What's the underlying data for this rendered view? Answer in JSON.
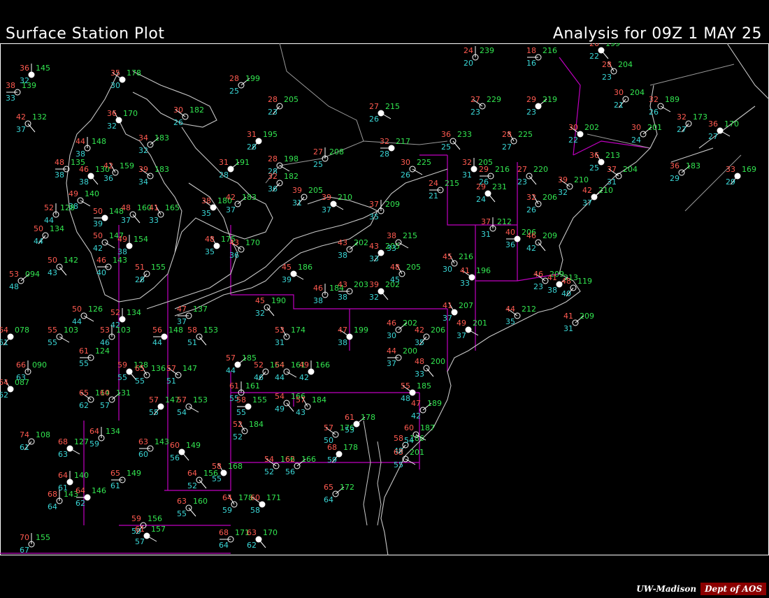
{
  "header": {
    "title_left": "Surface Station Plot",
    "title_right": "Analysis for 09Z  1 MAY 25"
  },
  "footer": {
    "credit_uw": "UW-Madison",
    "credit_dept": "Dept of AOS"
  },
  "colors": {
    "background": "#000000",
    "temperature": "#ff5a50",
    "dewpoint": "#3ad6d6",
    "pressure": "#32e650",
    "coastline": "#c8c8c8",
    "state_border": "#c000c0",
    "station": "#ffffff"
  },
  "stations": [
    {
      "t": "35",
      "td": "30",
      "p": "178"
    },
    {
      "t": "28",
      "td": "25",
      "p": "199"
    },
    {
      "t": "28",
      "td": "23",
      "p": "205"
    },
    {
      "t": "27",
      "td": "26",
      "p": "215"
    },
    {
      "t": "24",
      "td": "20",
      "p": "239"
    },
    {
      "t": "18",
      "td": "16",
      "p": "216"
    },
    {
      "t": "26",
      "td": "22",
      "p": "199"
    },
    {
      "t": "28",
      "td": "23",
      "p": "204"
    },
    {
      "t": "27",
      "td": "23",
      "p": "229"
    },
    {
      "t": "29",
      "td": "23",
      "p": "219"
    },
    {
      "t": "30",
      "td": "21",
      "p": "204"
    },
    {
      "t": "32",
      "td": "26",
      "p": "189"
    },
    {
      "t": "36",
      "td": "32",
      "p": "145"
    },
    {
      "t": "38",
      "td": "33",
      "p": "139"
    },
    {
      "t": "42",
      "td": "37",
      "p": "132"
    },
    {
      "t": "36",
      "td": "32",
      "p": "170"
    },
    {
      "t": "30",
      "td": "26",
      "p": "182"
    },
    {
      "t": "34",
      "td": "32",
      "p": "183"
    },
    {
      "t": "31",
      "td": "28",
      "p": "195"
    },
    {
      "t": "28",
      "td": "28",
      "p": "198"
    },
    {
      "t": "27",
      "td": "25",
      "p": "208"
    },
    {
      "t": "32",
      "td": "28",
      "p": "217"
    },
    {
      "t": "36",
      "td": "25",
      "p": "233"
    },
    {
      "t": "28",
      "td": "27",
      "p": "225"
    },
    {
      "t": "30",
      "td": "22",
      "p": "202"
    },
    {
      "t": "30",
      "td": "24",
      "p": "201"
    },
    {
      "t": "32",
      "td": "27",
      "p": "173"
    },
    {
      "t": "36",
      "td": "27",
      "p": "170"
    },
    {
      "t": "44",
      "td": "38",
      "p": "148"
    },
    {
      "t": "48",
      "td": "38",
      "p": "135"
    },
    {
      "t": "46",
      "td": "38",
      "p": "130"
    },
    {
      "t": "42",
      "td": "36",
      "p": "159"
    },
    {
      "t": "39",
      "td": "34",
      "p": "183"
    },
    {
      "t": "31",
      "td": "28",
      "p": "191"
    },
    {
      "t": "32",
      "td": "36",
      "p": "182"
    },
    {
      "t": "30",
      "td": "26",
      "p": "225"
    },
    {
      "t": "32",
      "td": "31",
      "p": "205"
    },
    {
      "t": "29",
      "td": "26",
      "p": "216"
    },
    {
      "t": "27",
      "td": "23",
      "p": "220"
    },
    {
      "t": "36",
      "td": "25",
      "p": "213"
    },
    {
      "t": "37",
      "td": "31",
      "p": "204"
    },
    {
      "t": "36",
      "td": "29",
      "p": "183"
    },
    {
      "t": "33",
      "td": "29",
      "p": "169"
    },
    {
      "t": "49",
      "td": "38",
      "p": "140"
    },
    {
      "t": "52",
      "td": "44",
      "p": "128"
    },
    {
      "t": "50",
      "td": "39",
      "p": "148"
    },
    {
      "t": "48",
      "td": "37",
      "p": "160"
    },
    {
      "t": "41",
      "td": "33",
      "p": "165"
    },
    {
      "t": "38",
      "td": "35",
      "p": "180"
    },
    {
      "t": "42",
      "td": "37",
      "p": "183"
    },
    {
      "t": "39",
      "td": "31",
      "p": "205"
    },
    {
      "t": "39",
      "td": "37",
      "p": "210"
    },
    {
      "t": "37",
      "td": "35",
      "p": "209"
    },
    {
      "t": "24",
      "td": "21",
      "p": "215"
    },
    {
      "t": "29",
      "td": "24",
      "p": "231"
    },
    {
      "t": "32",
      "td": "26",
      "p": "206"
    },
    {
      "t": "39",
      "td": "32",
      "p": "210"
    },
    {
      "t": "42",
      "td": "37",
      "p": "210"
    },
    {
      "t": "50",
      "td": "44",
      "p": "134"
    },
    {
      "t": "50",
      "td": "42",
      "p": "147"
    },
    {
      "t": "49",
      "td": "38",
      "p": "154"
    },
    {
      "t": "46",
      "td": "40",
      "p": "143"
    },
    {
      "t": "50",
      "td": "43",
      "p": "142"
    },
    {
      "t": "48",
      "td": "35",
      "p": "175"
    },
    {
      "t": "43",
      "td": "36",
      "p": "170"
    },
    {
      "t": "43",
      "td": "38",
      "p": "202"
    },
    {
      "t": "43",
      "td": "33",
      "p": "205"
    },
    {
      "t": "38",
      "td": "33",
      "p": "215"
    },
    {
      "t": "37",
      "td": "31",
      "p": "212"
    },
    {
      "t": "40",
      "td": "36",
      "p": "206"
    },
    {
      "t": "46",
      "td": "42",
      "p": "209"
    },
    {
      "t": "45",
      "td": "30",
      "p": "216"
    },
    {
      "t": "41",
      "td": "33",
      "p": "196"
    },
    {
      "t": "53",
      "td": "48",
      "p": "094"
    },
    {
      "t": "51",
      "td": "28",
      "p": "155"
    },
    {
      "t": "45",
      "td": "39",
      "p": "186"
    },
    {
      "t": "46",
      "td": "38",
      "p": "184"
    },
    {
      "t": "43",
      "td": "38",
      "p": "203"
    },
    {
      "t": "39",
      "td": "32",
      "p": "202"
    },
    {
      "t": "48",
      "td": "45",
      "p": "205"
    },
    {
      "t": "46",
      "td": "23",
      "p": "209"
    },
    {
      "t": "41",
      "td": "38",
      "p": "213"
    },
    {
      "t": "48",
      "td": "40",
      "p": "119"
    },
    {
      "t": "50",
      "td": "44",
      "p": "126"
    },
    {
      "t": "52",
      "td": "42",
      "p": "134"
    },
    {
      "t": "47",
      "td": "37",
      "p": "137"
    },
    {
      "t": "45",
      "td": "32",
      "p": "190"
    },
    {
      "t": "41",
      "td": "37",
      "p": "207"
    },
    {
      "t": "44",
      "td": "35",
      "p": "212"
    },
    {
      "t": "41",
      "td": "31",
      "p": "209"
    },
    {
      "t": "64",
      "td": "61",
      "p": "078"
    },
    {
      "t": "55",
      "td": "55",
      "p": "103"
    },
    {
      "t": "53",
      "td": "46",
      "p": "103"
    },
    {
      "t": "56",
      "td": "44",
      "p": "148"
    },
    {
      "t": "58",
      "td": "51",
      "p": "153"
    },
    {
      "t": "53",
      "td": "31",
      "p": "174"
    },
    {
      "t": "47",
      "td": "38",
      "p": "199"
    },
    {
      "t": "46",
      "td": "30",
      "p": "202"
    },
    {
      "t": "42",
      "td": "35",
      "p": "206"
    },
    {
      "t": "49",
      "td": "37",
      "p": "201"
    },
    {
      "t": "66",
      "td": "63",
      "p": "090"
    },
    {
      "t": "61",
      "td": "55",
      "p": "124"
    },
    {
      "t": "59",
      "td": "55",
      "p": "128"
    },
    {
      "t": "65",
      "td": "55",
      "p": "136"
    },
    {
      "t": "57",
      "td": "51",
      "p": "147"
    },
    {
      "t": "57",
      "td": "44",
      "p": "185"
    },
    {
      "t": "52",
      "td": "46",
      "p": "164"
    },
    {
      "t": "54",
      "td": "44",
      "p": "161"
    },
    {
      "t": "49",
      "td": "42",
      "p": "166"
    },
    {
      "t": "44",
      "td": "37",
      "p": "200"
    },
    {
      "t": "48",
      "td": "33",
      "p": "200"
    },
    {
      "t": "64",
      "td": "62",
      "p": "087"
    },
    {
      "t": "65",
      "td": "62",
      "p": "114"
    },
    {
      "t": "60",
      "td": "57",
      "p": "131"
    },
    {
      "t": "57",
      "td": "55",
      "p": "147"
    },
    {
      "t": "57",
      "td": "54",
      "p": "153"
    },
    {
      "t": "61",
      "td": "55",
      "p": "161"
    },
    {
      "t": "58",
      "td": "55",
      "p": "155"
    },
    {
      "t": "54",
      "td": "49",
      "p": "166"
    },
    {
      "t": "57",
      "td": "43",
      "p": "184"
    },
    {
      "t": "55",
      "td": "48",
      "p": "185"
    },
    {
      "t": "47",
      "td": "42",
      "p": "189"
    },
    {
      "t": "74",
      "td": "61",
      "p": "108"
    },
    {
      "t": "68",
      "td": "63",
      "p": "127"
    },
    {
      "t": "64",
      "td": "59",
      "p": "134"
    },
    {
      "t": "63",
      "td": "60",
      "p": "143"
    },
    {
      "t": "60",
      "td": "56",
      "p": "149"
    },
    {
      "t": "52",
      "td": "52",
      "p": "184"
    },
    {
      "t": "57",
      "td": "50",
      "p": "176"
    },
    {
      "t": "61",
      "td": "53",
      "p": "178"
    },
    {
      "t": "58",
      "td": "49",
      "p": "186"
    },
    {
      "t": "60",
      "td": "54",
      "p": "187"
    },
    {
      "t": "64",
      "td": "61",
      "p": "140"
    },
    {
      "t": "65",
      "td": "61",
      "p": "149"
    },
    {
      "t": "64",
      "td": "52",
      "p": "156"
    },
    {
      "t": "58",
      "td": "55",
      "p": "168"
    },
    {
      "t": "54",
      "td": "52",
      "p": "166"
    },
    {
      "t": "62",
      "td": "56",
      "p": "166"
    },
    {
      "t": "68",
      "td": "59",
      "p": "178"
    },
    {
      "t": "63",
      "td": "55",
      "p": "201"
    },
    {
      "t": "68",
      "td": "64",
      "p": "143"
    },
    {
      "t": "64",
      "td": "62",
      "p": "146"
    },
    {
      "t": "63",
      "td": "55",
      "p": "160"
    },
    {
      "t": "64",
      "td": "59",
      "p": "178"
    },
    {
      "t": "60",
      "td": "58",
      "p": "171"
    },
    {
      "t": "65",
      "td": "64",
      "p": "172"
    },
    {
      "t": "59",
      "td": "59",
      "p": "156"
    },
    {
      "t": "61",
      "td": "57",
      "p": "157"
    },
    {
      "t": "70",
      "td": "67",
      "p": "155"
    },
    {
      "t": "68",
      "td": "64",
      "p": "171"
    },
    {
      "t": "63",
      "td": "62",
      "p": "170"
    }
  ]
}
